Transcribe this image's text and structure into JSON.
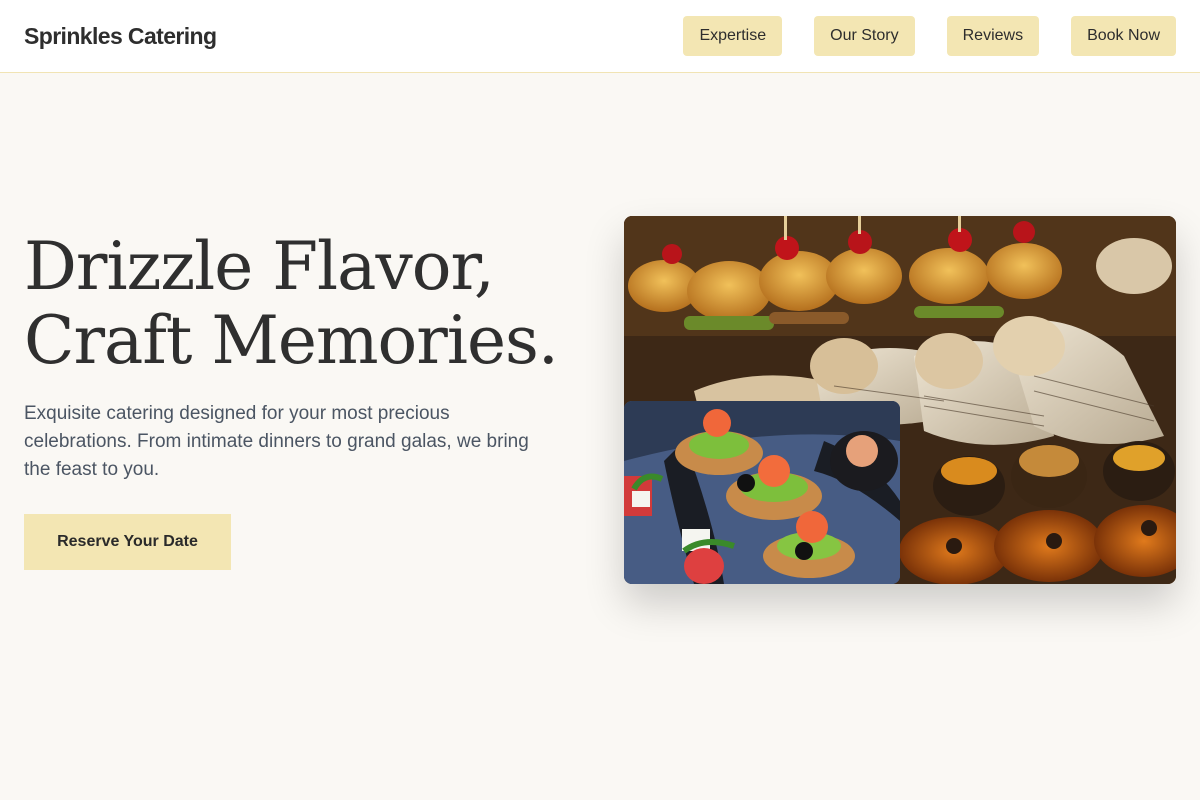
{
  "brand": "Sprinkles Catering",
  "nav": {
    "items": [
      {
        "label": "Expertise"
      },
      {
        "label": "Our Story"
      },
      {
        "label": "Reviews"
      },
      {
        "label": "Book Now"
      }
    ]
  },
  "hero": {
    "headline_line1": "Drizzle Flavor,",
    "headline_line2": "Craft Memories.",
    "subtext": "Exquisite catering designed for your most precious celebrations. From intimate dinners to grand galas, we bring the feast to you.",
    "cta_label": "Reserve Your Date"
  },
  "colors": {
    "accent": "#f3e6b3",
    "background": "#faf8f4",
    "text": "#2f2f2f",
    "muted": "#4b5563"
  }
}
